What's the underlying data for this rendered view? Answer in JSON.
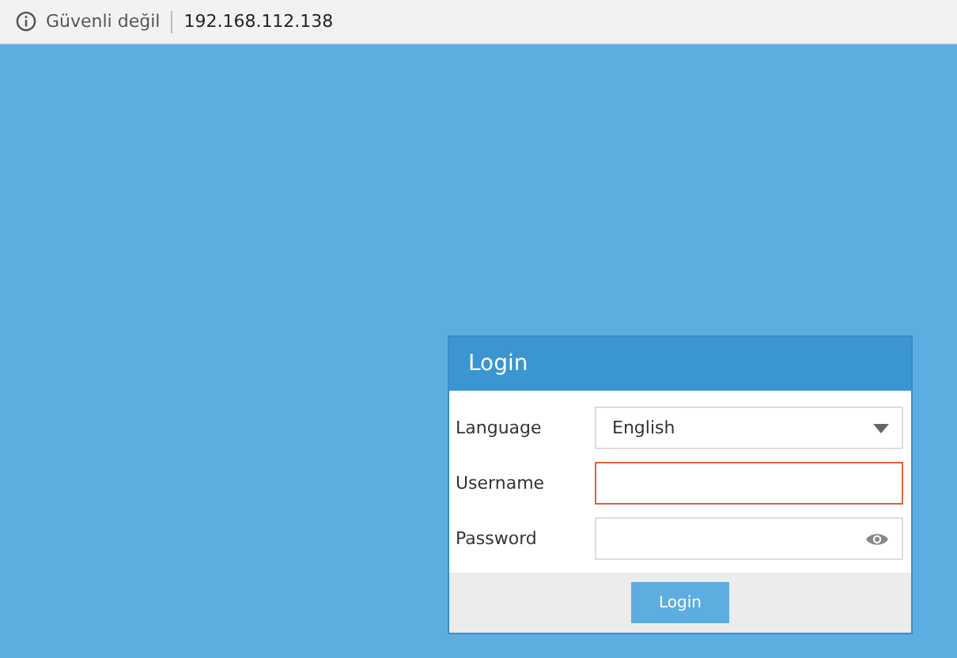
{
  "address_bar": {
    "security_label": "Güvenli değil",
    "url": "192.168.112.138"
  },
  "login_panel": {
    "title": "Login",
    "fields": [
      {
        "kind": "select",
        "label": "Language",
        "value": "English",
        "focused": false
      },
      {
        "kind": "text",
        "label": "Username",
        "focused": true
      },
      {
        "kind": "password",
        "label": "Password",
        "focused": false
      }
    ],
    "submit": "Login"
  }
}
